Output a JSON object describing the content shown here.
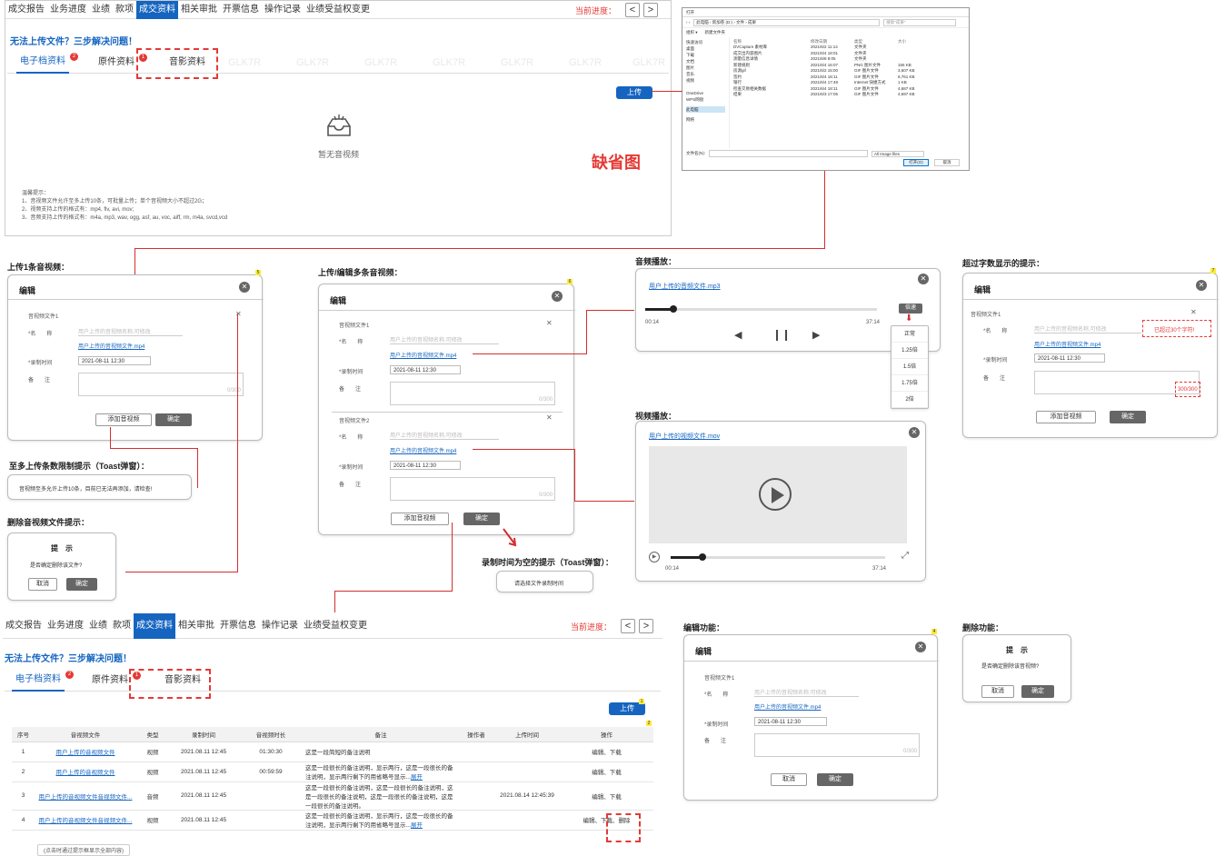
{
  "nav": {
    "items": [
      "成交报告",
      "业务进度",
      "业绩",
      "款项",
      "成交资料",
      "相关审批",
      "开票信息",
      "操作记录",
      "业绩受益权变更"
    ],
    "progress_label": "当前进度：",
    "prev": "<",
    "next": ">"
  },
  "help_title": "无法上传文件？三步解决问题！",
  "tabs": {
    "electronic": "电子档资料",
    "original": "原件资料",
    "media": "音影资料"
  },
  "badges": {
    "electronic": "2",
    "original": "1",
    "upload": "1",
    "table": "2",
    "one": "5",
    "multi": "6",
    "limit": "7",
    "edit": "4"
  },
  "upload_button": "上传",
  "watermark": "GLK7R",
  "empty": {
    "text": "暂无音视频",
    "caption": "缺省图"
  },
  "tips": {
    "title": "温馨提示：",
    "lines": [
      "1、音视频文件允许至多上传10条，可批量上传；单个音视频大小不超过2G；",
      "2、视频支持上传的格式有：mp4, flv, avi, mov;",
      "3、音频支持上传的格式有：m4a, mp3, wav, ogg, asf, au, voc, aiff, rm, m4a, svcd,vcd"
    ]
  },
  "file_dialog": {
    "title": "打开",
    "path": "此电脑 › 新加卷 (D:) › 文件 › 成果",
    "search": "搜索\"成果\"",
    "toolbar": [
      "组织 ▾",
      "新建文件夹"
    ],
    "sidebar": [
      "快速访问",
      "桌面",
      "下载",
      "文档",
      "图片",
      "音乐",
      "视频",
      "",
      "OneDrive",
      "WPS网盘",
      "",
      "此电脑",
      "",
      "网络"
    ],
    "columns": [
      "名称",
      "修改日期",
      "类型",
      "大小"
    ],
    "rows": [
      [
        "DVCapture 素材库",
        "2021/6/2 11:14",
        "文件夹",
        ""
      ],
      [
        "成交出内容图片",
        "2021/6/4 18:01",
        "文件夹",
        ""
      ],
      [
        "测量信息详情",
        "2021/6/8 8:05",
        "文件夹",
        ""
      ],
      [
        "新建规则",
        "2021/6/4 16:07",
        "PNG 图片文件",
        "156 KB"
      ],
      [
        "房源gif",
        "2021/6/2 15:00",
        "GIF 图片文件",
        "3,607 KB"
      ],
      [
        "签约",
        "2021/6/4 18:11",
        "GIF 图片文件",
        "8,761 KB"
      ],
      [
        "银行",
        "2021/6/4 17:48",
        "Internet 快捷方式",
        "1 KB"
      ],
      [
        "检查交易相关数据",
        "2021/6/4 18:11",
        "GIF 图片文件",
        "4,687 KB"
      ],
      [
        "结果",
        "2021/6/3 17:05",
        "GIF 图片文件",
        "4,697 KB"
      ]
    ],
    "filename_label": "文件名(N):",
    "filetype": "All Image files",
    "open": "打开(O)",
    "cancel": "取消"
  },
  "sections": {
    "upload_one": "上传1条音视频：",
    "upload_multi": "上传/编辑多条音视频：",
    "audio_play": "音频播放：",
    "over_limit": "超过字数显示的提示：",
    "limit_toast": "至多上传条数限制提示（Toast弹窗）：",
    "delete_hint": "删除音视频文件提示：",
    "video_play": "视频播放：",
    "time_empty": "录制时间为空的提示（Toast弹窗）：",
    "edit_func": "编辑功能：",
    "delete_func": "删除功能："
  },
  "form": {
    "edit_title": "编辑",
    "file1": "音视频文件1",
    "file2": "音视频文件2",
    "name_label": "*名　　称",
    "name_placeholder": "用户上传的音视频名称,可修改",
    "file_link": "用户上传的音视频文件.mp4",
    "time_label": "*录制时间",
    "time_value": "2021-08-11 12:30",
    "note_label": "备　　注",
    "count": "0/300",
    "count_over": "300/300",
    "add_button": "添加音视频",
    "confirm_button": "确定",
    "cancel_button": "取消",
    "over_tip": "已超过30个字符!"
  },
  "toasts": {
    "limit": "音视频至多允许上传10条，目前已无法再添加，请检查!",
    "time_empty": "请选择文件录制时间"
  },
  "confirm": {
    "title": "提　示",
    "msg1": "是否确定删除该文件?",
    "msg2": "是否确定删除该音视频?",
    "cancel": "取消",
    "ok": "确定"
  },
  "audio": {
    "link": "用户上传的音频文件.mp3",
    "current": "00:14",
    "total": "37:14",
    "speed_button": "倍速",
    "speeds": [
      "正常",
      "1.25倍",
      "1.5倍",
      "1.75倍",
      "2倍"
    ],
    "progress": 0.12
  },
  "video": {
    "link": "用户上传的视频文件.mov",
    "current": "00:14",
    "total": "37:14",
    "progress": 0.15
  },
  "table": {
    "headers": [
      "序号",
      "音视频文件",
      "类型",
      "录制时间",
      "音视频时长",
      "备注",
      "操作者",
      "上传时间",
      "操作"
    ],
    "rows": [
      {
        "no": "1",
        "file": "用户上传的音视频文件",
        "type": "视频",
        "time": "2021.08.11 12:45",
        "dur": "01:30:30",
        "note": "这是一段简短的备注说明",
        "op": "",
        "up": "",
        "act": "编辑、下载",
        "more": ""
      },
      {
        "no": "2",
        "file": "用户上传的音视频文件",
        "type": "视频",
        "time": "2021.08.11 12:45",
        "dur": "00:59:59",
        "note": "这是一段很长的备注说明，显示两行，这是一段很长的备注说明，显示两行剩下的用省略号显示...",
        "op": "",
        "up": "",
        "act": "编辑、下载",
        "more": "展开"
      },
      {
        "no": "3",
        "file": "用户上传的音视频文件音视频文件...",
        "type": "音频",
        "time": "2021.08.11 12:45",
        "dur": "",
        "note": "这是一段很长的备注说明，这是一段很长的备注说明，这是一段很长的备注说明，这是一段很长的备注说明，这是一段很长的备注说明。",
        "op": "",
        "up": "2021.08.14 12:45:39",
        "act": "编辑、下载",
        "more": ""
      },
      {
        "no": "4",
        "file": "用户上传的音视频文件音视频文件...",
        "type": "视频",
        "time": "2021.08.11 12:45",
        "dur": "",
        "note": "这是一段很长的备注说明，显示两行，这是一段很长的备注说明，显示两行剩下的用省略号显示...",
        "op": "",
        "up": "",
        "act": "编辑、下载、删除",
        "more": "展开"
      }
    ],
    "tooltip": "(点击时通过提示框显示全部内容)"
  },
  "colors": {
    "accent": "#1565c0",
    "danger": "#e53935",
    "annotation": "#d32f2f"
  }
}
